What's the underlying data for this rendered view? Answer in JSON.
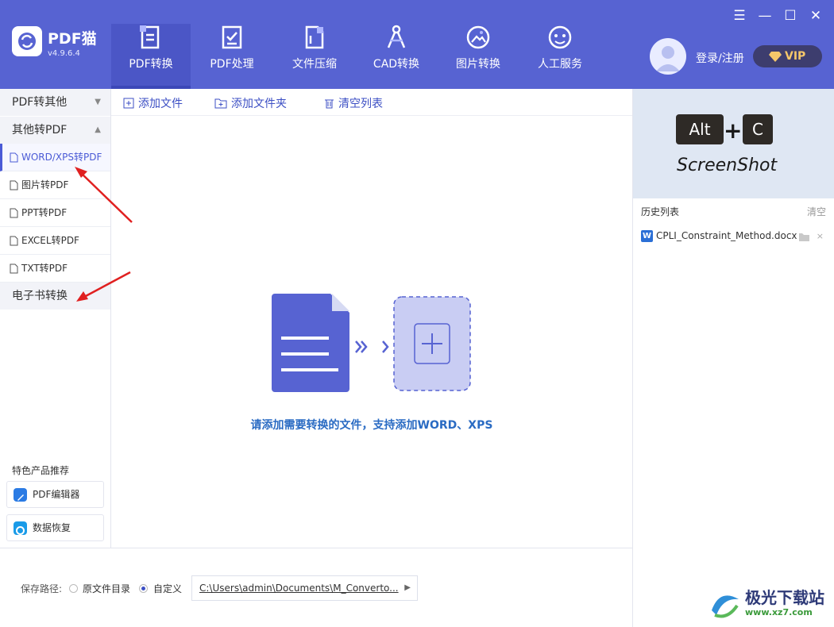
{
  "app": {
    "name": "PDF猫",
    "version": "v4.9.6.4",
    "brand_color": "#5763d2",
    "accent_color": "#3c4fc4"
  },
  "nav": {
    "tabs": [
      {
        "label": "PDF转换",
        "icon": "pdf-convert-icon",
        "active": true
      },
      {
        "label": "PDF处理",
        "icon": "pdf-edit-icon",
        "active": false
      },
      {
        "label": "文件压缩",
        "icon": "compress-icon",
        "active": false
      },
      {
        "label": "CAD转换",
        "icon": "cad-icon",
        "active": false
      },
      {
        "label": "图片转换",
        "icon": "image-icon",
        "active": false
      },
      {
        "label": "人工服务",
        "icon": "service-icon",
        "active": false
      }
    ]
  },
  "window_controls": {
    "menu": "☰",
    "minimize": "—",
    "maximize": "☐",
    "close": "✕"
  },
  "user": {
    "login_label": "登录/注册",
    "vip_label": "VIP"
  },
  "sidebar": {
    "groups": [
      {
        "label": "PDF转其他",
        "caret": "▼"
      },
      {
        "label": "其他转PDF",
        "caret": "▲"
      }
    ],
    "items": [
      {
        "label": "WORD/XPS转PDF",
        "active": true
      },
      {
        "label": "图片转PDF",
        "active": false
      },
      {
        "label": "PPT转PDF",
        "active": false
      },
      {
        "label": "EXCEL转PDF",
        "active": false
      },
      {
        "label": "TXT转PDF",
        "active": false
      }
    ],
    "ebook_group": "电子书转换",
    "recommend_title": "特色产品推荐",
    "recommend_items": [
      {
        "label": "PDF编辑器",
        "icon": "pdf-editor-icon"
      },
      {
        "label": "数据恢复",
        "icon": "data-recovery-icon"
      }
    ]
  },
  "toolbar": {
    "add_file": "添加文件",
    "add_folder": "添加文件夹",
    "clear_list": "清空列表"
  },
  "main": {
    "hint": "请添加需要转换的文件，支持添加WORD、XPS"
  },
  "right_panel": {
    "banner": {
      "key1": "Alt",
      "plus": "+",
      "key2": "C",
      "caption": "ScreenShot"
    },
    "history_title": "历史列表",
    "history_clear": "清空",
    "history_items": [
      {
        "name": "CPLI_Constraint_Method.docx",
        "type_badge": "W"
      }
    ]
  },
  "bottom": {
    "save_path_label": "保存路径:",
    "option_original": "原文件目录",
    "option_custom": "自定义",
    "selected_option": "自定义",
    "path_value": "C:\\Users\\admin\\Documents\\M_Converto...",
    "path_arrow": "▶"
  },
  "watermark": {
    "title": "极光下载站",
    "url": "www.xz7.com"
  }
}
